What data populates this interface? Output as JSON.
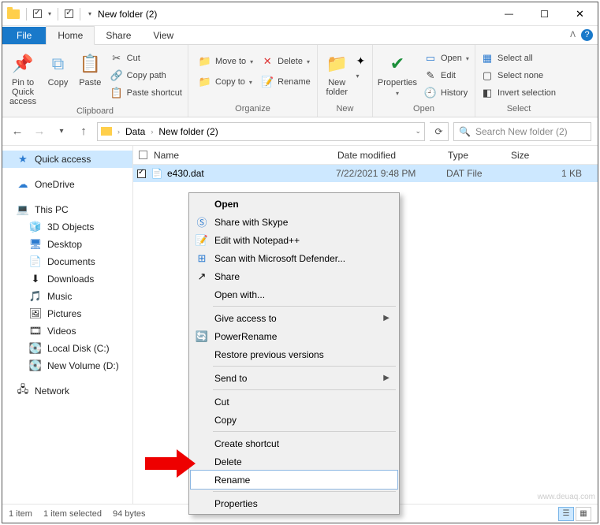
{
  "title": "New folder (2)",
  "tabs": {
    "file": "File",
    "home": "Home",
    "share": "Share",
    "view": "View"
  },
  "ribbon": {
    "clipboard": {
      "label": "Clipboard",
      "pin": "Pin to Quick access",
      "copy": "Copy",
      "paste": "Paste",
      "cut": "Cut",
      "copypath": "Copy path",
      "pasteshortcut": "Paste shortcut"
    },
    "organize": {
      "label": "Organize",
      "moveto": "Move to",
      "copyto": "Copy to",
      "delete": "Delete",
      "rename": "Rename"
    },
    "new": {
      "label": "New",
      "newfolder": "New folder"
    },
    "open": {
      "label": "Open",
      "properties": "Properties",
      "open": "Open",
      "edit": "Edit",
      "history": "History"
    },
    "select": {
      "label": "Select",
      "all": "Select all",
      "none": "Select none",
      "invert": "Invert selection"
    }
  },
  "address": {
    "crumbs": [
      "Data",
      "New folder (2)"
    ],
    "search_placeholder": "Search New folder (2)"
  },
  "nav": {
    "quick": "Quick access",
    "onedrive": "OneDrive",
    "thispc": "This PC",
    "obj3d": "3D Objects",
    "desktop": "Desktop",
    "documents": "Documents",
    "downloads": "Downloads",
    "music": "Music",
    "pictures": "Pictures",
    "videos": "Videos",
    "cdrive": "Local Disk (C:)",
    "ddrive": "New Volume (D:)",
    "network": "Network"
  },
  "columns": {
    "name": "Name",
    "date": "Date modified",
    "type": "Type",
    "size": "Size"
  },
  "file": {
    "name": "e430.dat",
    "date": "7/22/2021 9:48 PM",
    "type": "DAT File",
    "size": "1 KB"
  },
  "context": {
    "open": "Open",
    "skype": "Share with Skype",
    "notepad": "Edit with Notepad++",
    "defender": "Scan with Microsoft Defender...",
    "share": "Share",
    "openwith": "Open with...",
    "giveaccess": "Give access to",
    "powerrename": "PowerRename",
    "restore": "Restore previous versions",
    "sendto": "Send to",
    "cut": "Cut",
    "copy": "Copy",
    "shortcut": "Create shortcut",
    "delete": "Delete",
    "rename": "Rename",
    "properties": "Properties"
  },
  "status": {
    "count": "1 item",
    "selected": "1 item selected",
    "bytes": "94 bytes"
  },
  "watermark": "www.deuaq.com"
}
